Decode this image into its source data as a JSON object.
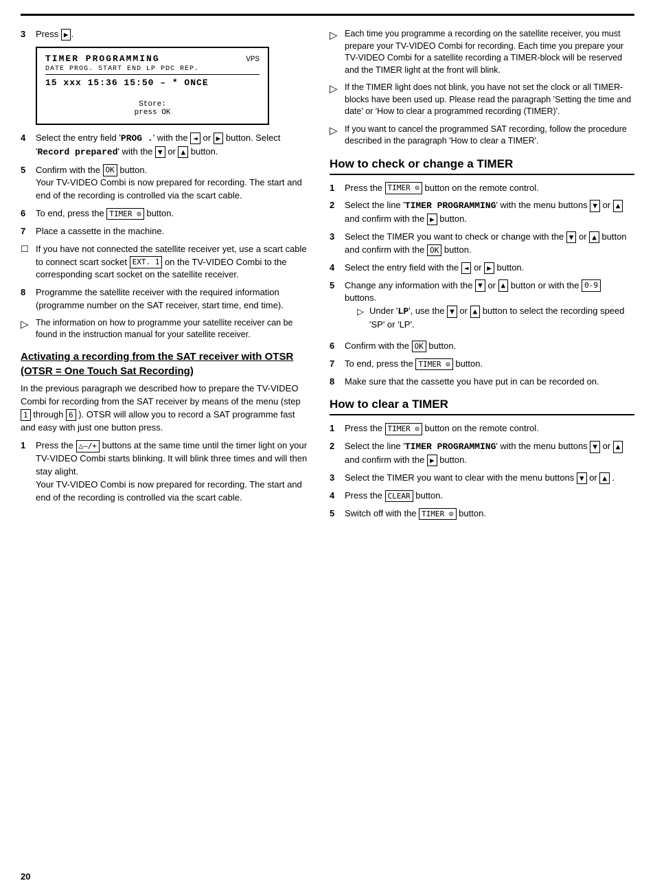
{
  "page": {
    "number": "20",
    "top_rule": true
  },
  "left": {
    "step3_label": "3",
    "step3_text": "Press",
    "step3_btn": "▶",
    "timer_screen": {
      "title": "TIMER PROGRAMMING",
      "vps": "VPS",
      "header": "DATE PROG.  START END   LP PDC REP.",
      "row": "15  xxx    15:36 15:50 –   *  ONCE",
      "store_line1": "Store:",
      "store_line2": "press OK"
    },
    "step4_label": "4",
    "step4_text_a": "Select the entry field '",
    "step4_prog": "PROG .",
    "step4_text_b": "' with the",
    "step4_btn_left": "◄",
    "step4_text_c": "or",
    "step4_btn_right": "▶",
    "step4_text_d": "button. Select '",
    "step4_record": "Record prepared",
    "step4_text_e": "' with the",
    "step4_btn_down": "▼",
    "step4_text_f": "or",
    "step4_btn_up": "▲",
    "step4_text_g": "button.",
    "step5_label": "5",
    "step5_text_a": "Confirm with the",
    "step5_btn_ok": "OK",
    "step5_text_b": "button.",
    "step5_detail": "Your TV-VIDEO Combi is now prepared for recording. The start and end of the recording is controlled via the scart cable.",
    "step6_label": "6",
    "step6_text_a": "To end, press the",
    "step6_btn": "TIMER ⊙",
    "step6_text_b": "button.",
    "step7_label": "7",
    "step7_text": "Place a cassette in the machine.",
    "checkbox_text": "If you have not connected the satellite receiver yet, use a scart cable to connect scart socket",
    "checkbox_btn": "EXT. 1",
    "checkbox_text2": "on the TV-VIDEO Combi to the corresponding scart socket on the satellite receiver.",
    "step8_label": "8",
    "step8_text": "Programme the satellite receiver with the required information (programme number on the SAT receiver, start time, end time).",
    "note_text": "The information on how to programme your satellite receiver can be found in the instruction manual for your satellite receiver.",
    "sat_title": "Activating a recording from the SAT receiver with OTSR (OTSR = One Touch Sat Recording)",
    "sat_para1": "In the previous paragraph we described how to prepare the TV-VIDEO Combi for recording from the SAT receiver by means of the menu (step",
    "sat_para1_s1": "1",
    "sat_para1_mid": "through",
    "sat_para1_s6": "6",
    "sat_para1_end": "). OTSR will allow you to record a SAT programme fast and easy with just one button press.",
    "sat_step1_label": "1",
    "sat_step1_text_a": "Press the",
    "sat_step1_btn": "△–/+",
    "sat_step1_text_b": "buttons at the same time until the timer light on your TV-VIDEO Combi starts blinking. It will blink three times and will then stay alight.",
    "sat_step1_detail": "Your TV-VIDEO Combi is now prepared for recording. The start and end of the recording is controlled via the scart cable."
  },
  "right": {
    "note1": "Each time you programme a recording on the satellite receiver, you must prepare your TV-VIDEO Combi for recording. Each time you prepare your TV-VIDEO Combi for a satellite recording a TIMER-block will be reserved and the TIMER light at the front will blink.",
    "note2": "If the TIMER light does not blink, you have not set the clock or all TIMER-blocks have been used up. Please read the paragraph 'Setting the time and date' or 'How to clear a programmed recording (TIMER)'.",
    "note3": "If you want to cancel the programmed SAT recording, follow the procedure described in the paragraph 'How to clear a TIMER'.",
    "check_section": {
      "title": "How to check or change a TIMER",
      "step1_label": "1",
      "step1_text_a": "Press the",
      "step1_btn": "TIMER ⊙",
      "step1_text_b": "button on the remote control.",
      "step2_label": "2",
      "step2_text_a": "Select the line '",
      "step2_bold": "TIMER PROGRAMMING",
      "step2_text_b": "' with the menu buttons",
      "step2_btn_down": "▼",
      "step2_text_c": "or",
      "step2_btn_up": "▲",
      "step2_text_d": "and confirm with the",
      "step2_btn_right": "▶",
      "step2_text_e": "button.",
      "step3_label": "3",
      "step3_text_a": "Select the TIMER you want to check or change with the",
      "step3_btn_down": "▼",
      "step3_text_b": "or",
      "step3_btn_up": "▲",
      "step3_text_c": "button and confirm with the",
      "step3_btn_ok": "OK",
      "step3_text_d": "button.",
      "step4_label": "4",
      "step4_text_a": "Select the entry field with the",
      "step4_btn_left": "◄",
      "step4_text_b": "or",
      "step4_btn_right": "▶",
      "step4_text_c": "button.",
      "step5_label": "5",
      "step5_text_a": "Change any information with the",
      "step5_btn_down": "▼",
      "step5_text_b": "or",
      "step5_btn_up": "▲",
      "step5_text_c": "button or with the",
      "step5_btn_09": "0-9",
      "step5_text_d": "buttons.",
      "step5_note_a": "Under '",
      "step5_note_lp": "LP",
      "step5_note_b": "', use the",
      "step5_note_btn_down": "▼",
      "step5_note_text_or": "or",
      "step5_note_btn_up": "▲",
      "step5_note_c": "button to select the recording speed 'SP' or 'LP'.",
      "step6_label": "6",
      "step6_text_a": "Confirm with the",
      "step6_btn_ok": "OK",
      "step6_text_b": "button.",
      "step7_label": "7",
      "step7_text_a": "To end, press the",
      "step7_btn": "TIMER ⊙",
      "step7_text_b": "button.",
      "step8_label": "8",
      "step8_text": "Make sure that the cassette you have put in can be recorded on."
    },
    "clear_section": {
      "title": "How to clear a TIMER",
      "step1_label": "1",
      "step1_text_a": "Press the",
      "step1_btn": "TIMER ⊙",
      "step1_text_b": "button on the remote control.",
      "step2_label": "2",
      "step2_text_a": "Select the line '",
      "step2_bold": "TIMER PROGRAMMING",
      "step2_text_b": "' with the menu buttons",
      "step2_btn_down": "▼",
      "step2_text_c": "or",
      "step2_btn_up": "▲",
      "step2_text_d": "and confirm with the",
      "step2_btn_right": "▶",
      "step2_text_e": "button.",
      "step3_label": "3",
      "step3_text_a": "Select the TIMER you want to clear with the menu buttons",
      "step3_btn_down": "▼",
      "step3_text_b": "or",
      "step3_btn_up": "▲",
      "step3_text_c": ".",
      "step4_label": "4",
      "step4_text_a": "Press the",
      "step4_btn": "CLEAR",
      "step4_text_b": "button.",
      "step5_label": "5",
      "step5_text_a": "Switch off with the",
      "step5_btn": "TIMER ⊙",
      "step5_text_b": "button."
    }
  }
}
